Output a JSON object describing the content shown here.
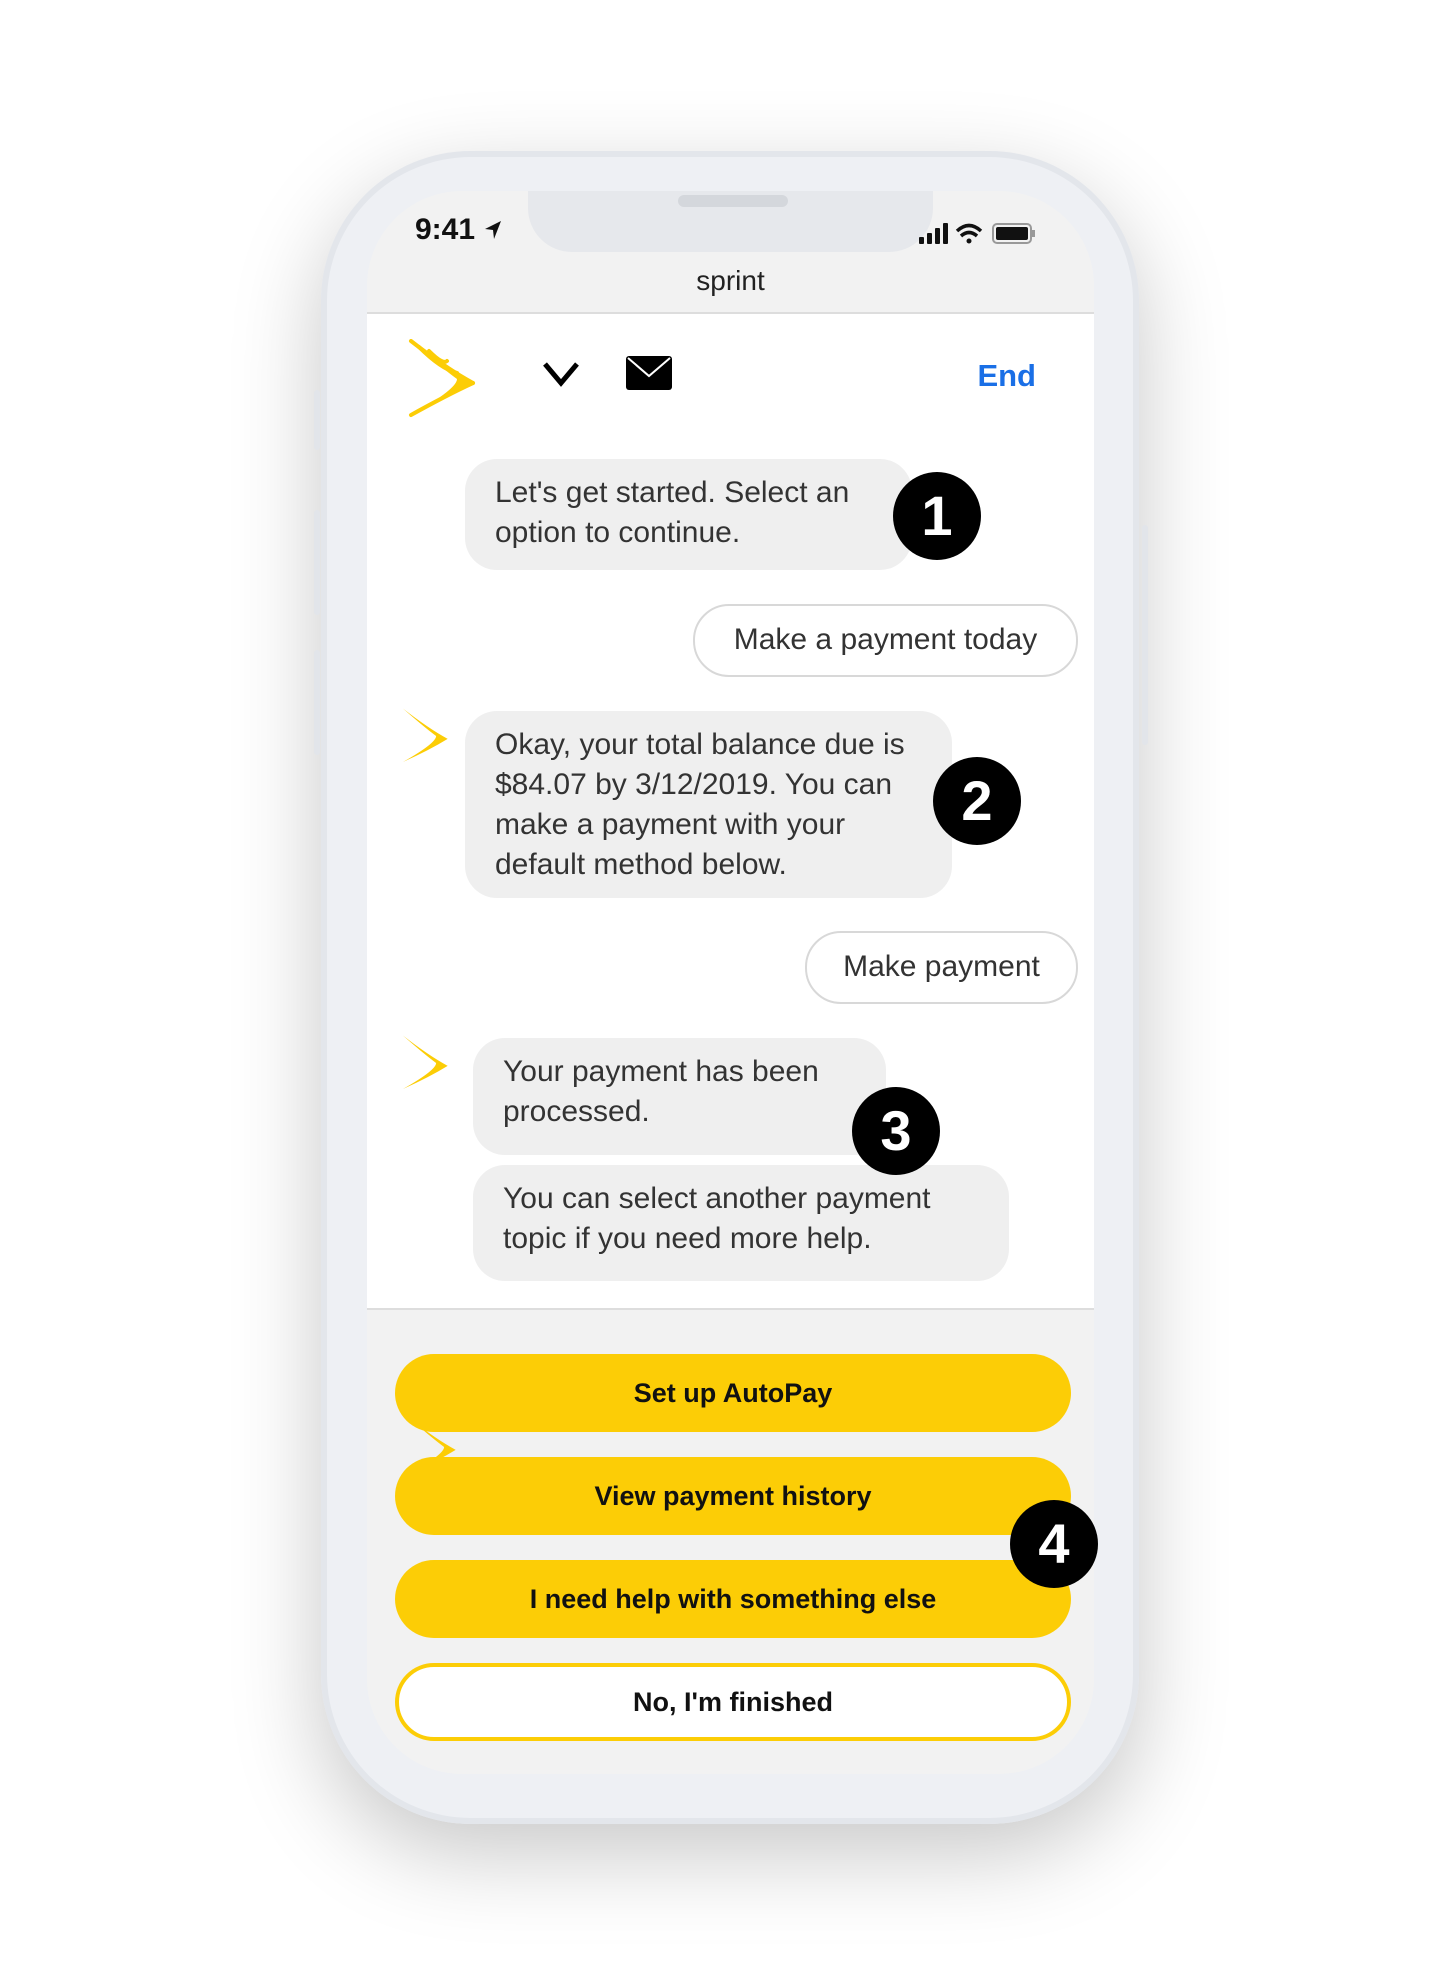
{
  "status_bar": {
    "time": "9:41",
    "icons": [
      "location-arrow-icon",
      "signal-icon",
      "wifi-icon",
      "battery-icon"
    ]
  },
  "browser": {
    "title": "sprint"
  },
  "header": {
    "logo": "sprint-logo",
    "icons": [
      "chevron-down-icon",
      "mail-icon"
    ],
    "end_label": "End"
  },
  "messages": [
    {
      "from": "bot",
      "text": "Let's get started. Select an option to continue."
    },
    {
      "from": "user",
      "text": "Make a payment today"
    },
    {
      "from": "bot",
      "text": "Okay, your total balance due is $84.07 by 3/12/2019. You can make a payment with your default method below."
    },
    {
      "from": "user",
      "text": "Make payment"
    },
    {
      "from": "bot",
      "text": "Your payment has been processed."
    },
    {
      "from": "bot",
      "text": "You can select another payment topic if you need more help."
    }
  ],
  "options": [
    "Set up AutoPay",
    "View payment history",
    "I need help with something else",
    "No, I'm finished"
  ],
  "annotations": [
    "1",
    "2",
    "3",
    "4"
  ],
  "colors": {
    "accent": "#fccd06",
    "link": "#1a6fe6"
  }
}
